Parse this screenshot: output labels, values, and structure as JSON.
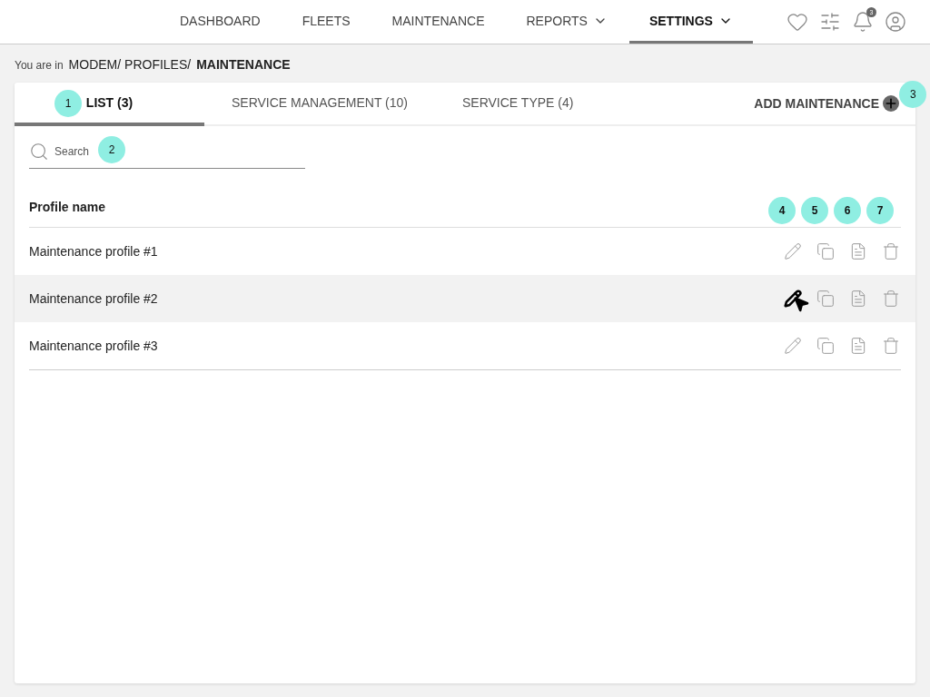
{
  "nav": {
    "items": [
      {
        "label": "DASHBOARD",
        "selected": false,
        "dropdown": false
      },
      {
        "label": "FLEETS",
        "selected": false,
        "dropdown": false
      },
      {
        "label": "MAINTENANCE",
        "selected": false,
        "dropdown": false
      },
      {
        "label": "REPORTS",
        "selected": false,
        "dropdown": true
      },
      {
        "label": "SETTINGS",
        "selected": true,
        "dropdown": true
      }
    ],
    "notification_count": "3"
  },
  "breadcrumb": {
    "prefix": "You are in",
    "path": "MODEM/ PROFILES/",
    "current": "MAINTENANCE"
  },
  "tabs": [
    {
      "label": "LIST (3)",
      "selected": true,
      "callout": "1"
    },
    {
      "label": "SERVICE MANAGEMENT (10)",
      "selected": false
    },
    {
      "label": "SERVICE TYPE (4)",
      "selected": false
    }
  ],
  "add_button": {
    "label": "ADD MAINTENANCE",
    "callout": "3"
  },
  "search": {
    "placeholder": "Search",
    "callout": "2"
  },
  "table": {
    "column": "Profile name",
    "action_callouts": [
      "4",
      "5",
      "6",
      "7"
    ],
    "rows": [
      {
        "name": "Maintenance profile #1",
        "hovered": false
      },
      {
        "name": "Maintenance profile #2",
        "hovered": true
      },
      {
        "name": "Maintenance profile #3",
        "hovered": false
      }
    ]
  }
}
